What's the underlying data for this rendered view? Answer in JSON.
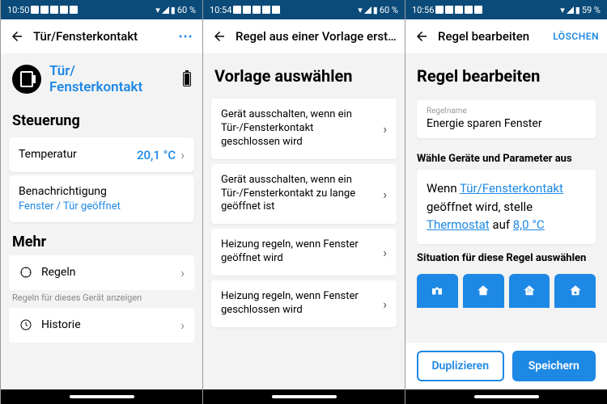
{
  "s1": {
    "time": "10:50",
    "battery": "60 %",
    "appbar_title": "Tür/Fensterkontakt",
    "device_name": "Tür/\nFensterkontakt",
    "sect_control": "Steuerung",
    "temp_label": "Temperatur",
    "temp_value": "20,1 °C",
    "notif_label": "Benachrichtigung",
    "notif_sub": "Fenster / Tür geöffnet",
    "sect_more": "Mehr",
    "rules_label": "Regeln",
    "rules_hint": "Regeln für dieses Gerät anzeigen",
    "history_label": "Historie"
  },
  "s2": {
    "time": "10:54",
    "battery": "60 %",
    "appbar_title": "Regel aus einer Vorlage erst…",
    "heading": "Vorlage auswählen",
    "templates": [
      "Gerät ausschalten, wenn ein Tür-/Fensterkontakt geschlossen wird",
      "Gerät ausschalten, wenn ein Tür-/Fensterkontakt zu lange geöffnet ist",
      "Heizung regeln, wenn Fenster geöffnet wird",
      "Heizung regeln, wenn Fenster geschlossen wird"
    ]
  },
  "s3": {
    "time": "10:56",
    "battery": "59 %",
    "appbar_title": "Regel bearbeiten",
    "delete": "LÖSCHEN",
    "heading": "Regel bearbeiten",
    "field_label": "Regelname",
    "field_value": "Energie sparen Fenster",
    "params_heading": "Wähle Geräte und Parameter aus",
    "sentence_p1": "Wenn ",
    "sentence_l1": "Tür/Fensterkontakt",
    "sentence_p2": " geöffnet wird, stelle ",
    "sentence_l2": "Thermostat",
    "sentence_p3": "  auf ",
    "sentence_l3": "8,0 °C",
    "situation_heading": "Situation für diese Regel auswählen",
    "btn_duplicate": "Duplizieren",
    "btn_save": "Speichern"
  }
}
